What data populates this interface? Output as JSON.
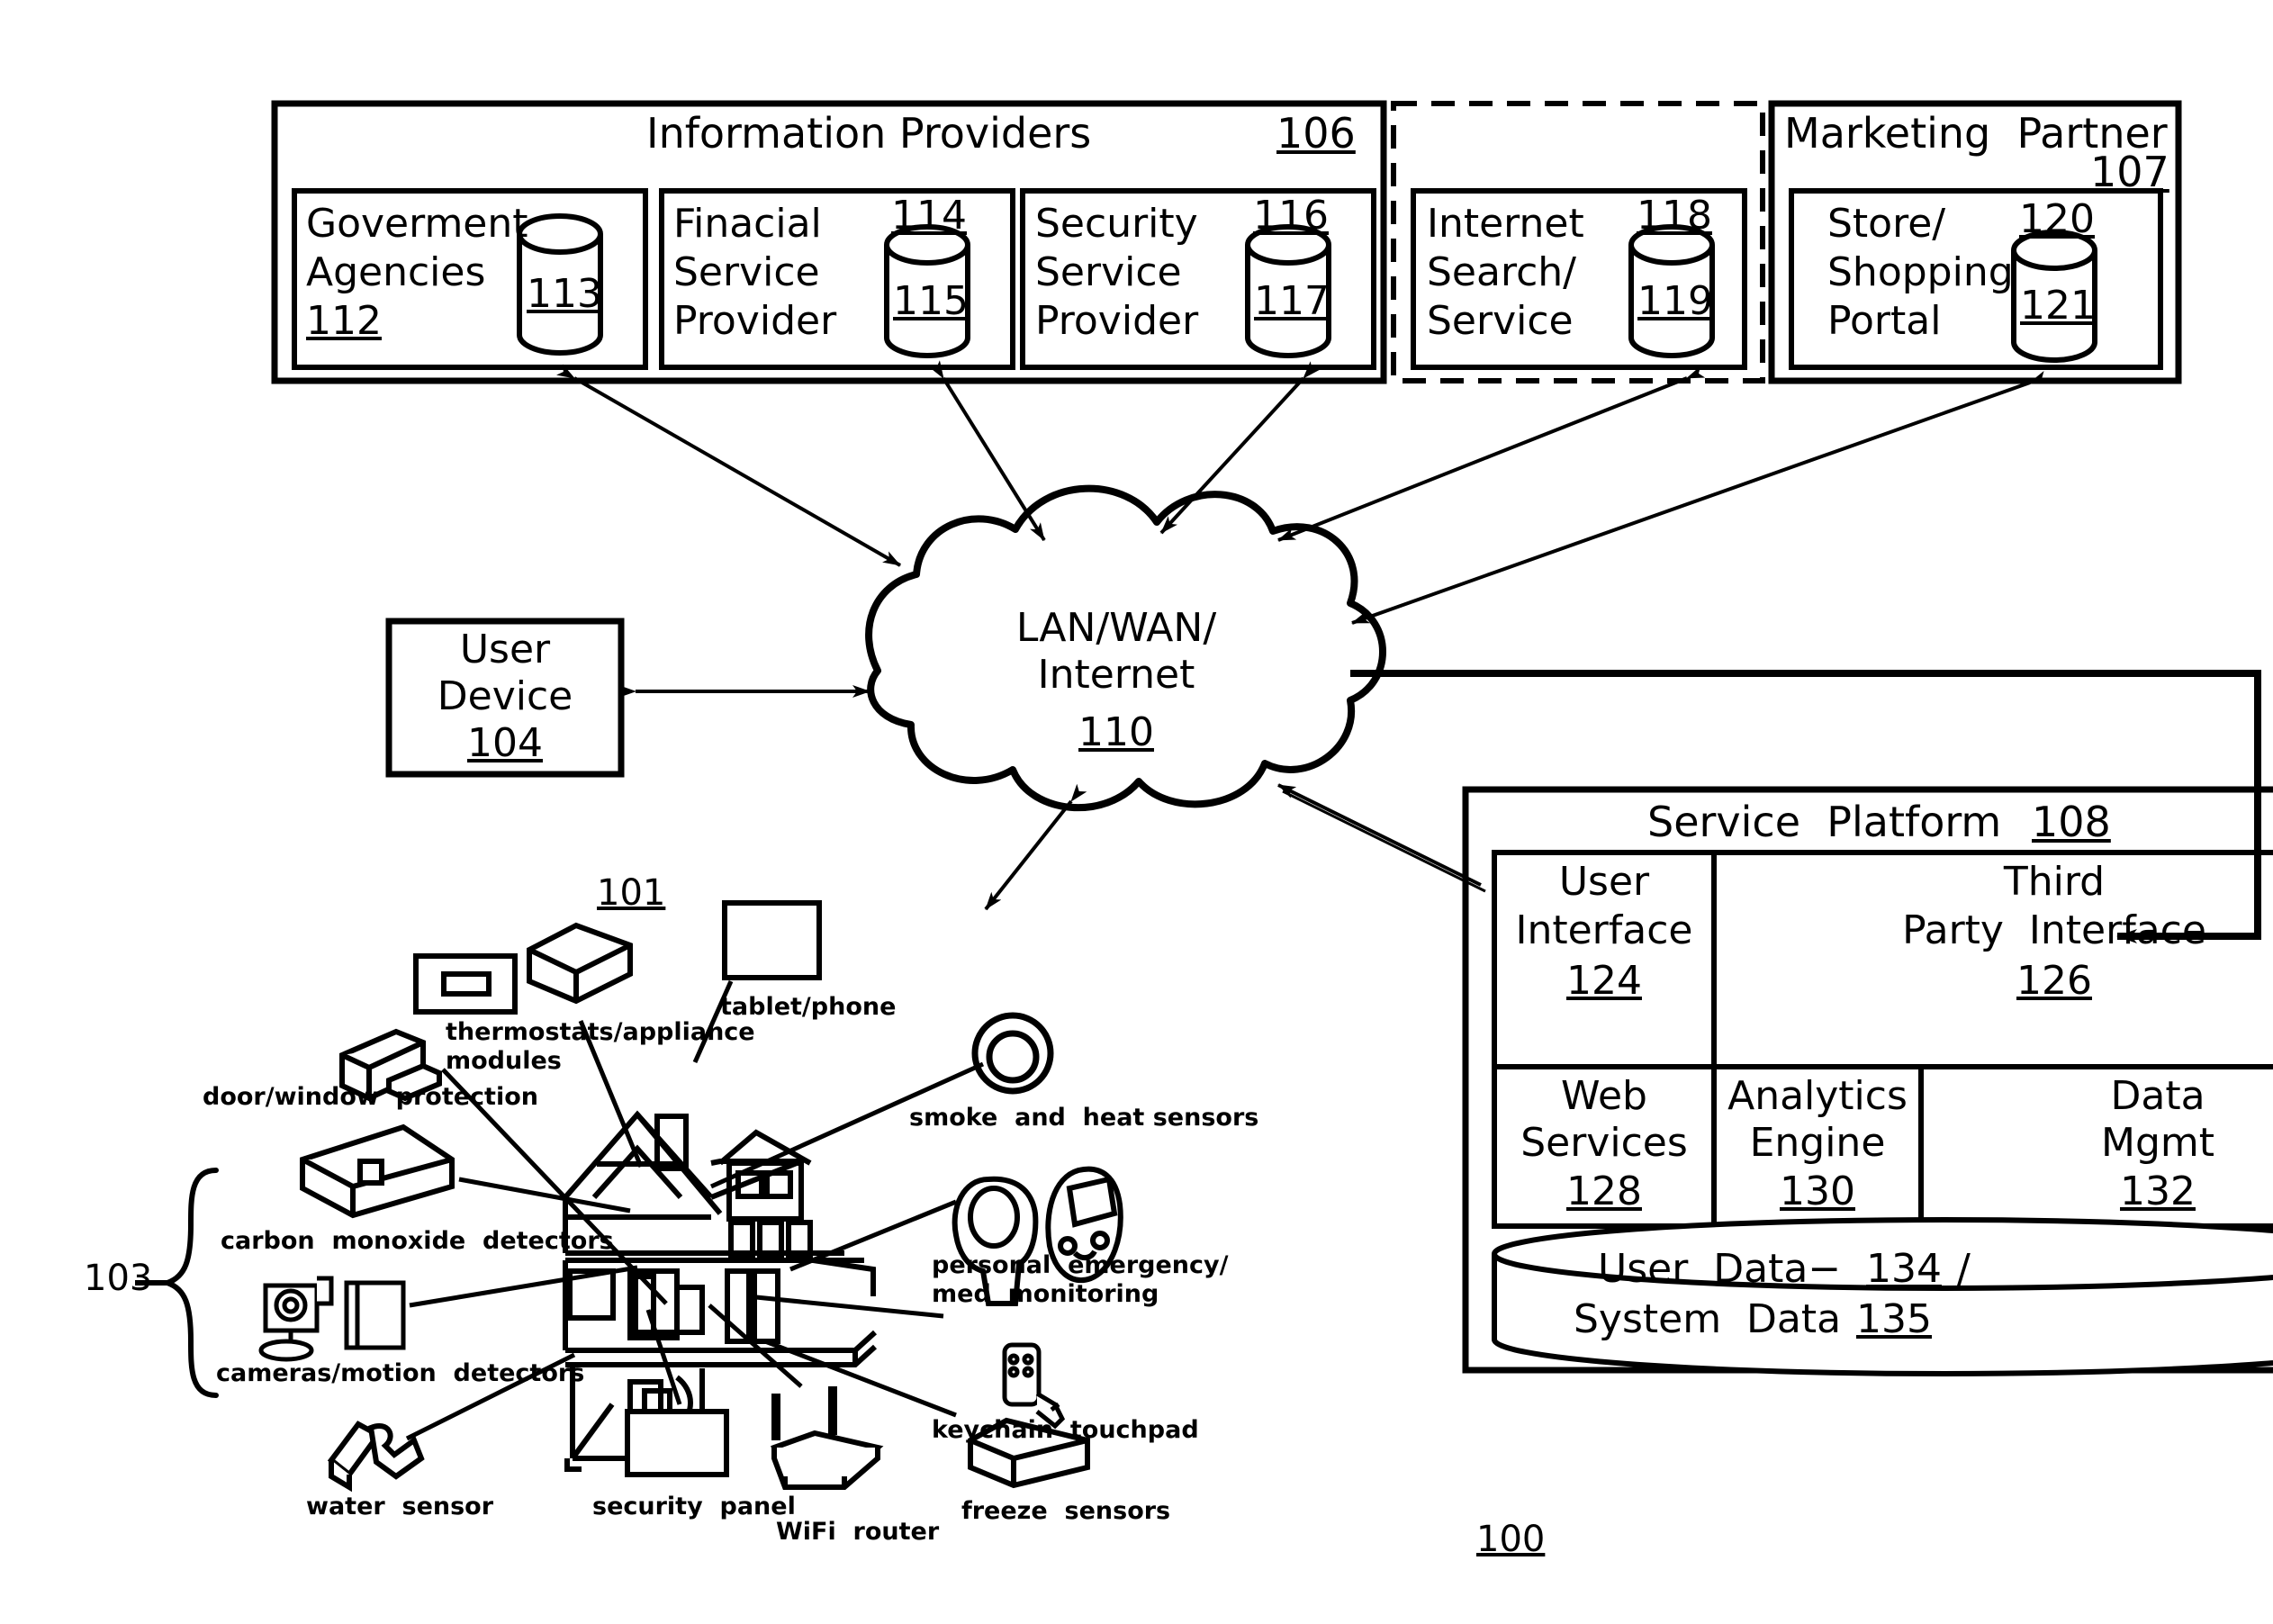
{
  "figure": {
    "number": "100"
  },
  "top_groups": [
    {
      "title": "Information Providers",
      "ref": "106",
      "border": "solid",
      "boxes": [
        {
          "lines": [
            "Goverment",
            "Agencies"
          ],
          "box_ref": "112",
          "box_ref_inline": true,
          "db_ref": "113"
        },
        {
          "lines": [
            "Finacial",
            "Service",
            "Provider"
          ],
          "box_ref": "114",
          "box_ref_inline": false,
          "db_ref": "115"
        },
        {
          "lines": [
            "Security",
            "Service",
            "Provider"
          ],
          "box_ref": "116",
          "box_ref_inline": false,
          "db_ref": "117"
        }
      ]
    },
    {
      "title": "",
      "ref": "",
      "border": "dashed",
      "boxes": [
        {
          "lines": [
            "Internet",
            "Search/",
            "Service"
          ],
          "box_ref": "118",
          "box_ref_inline": false,
          "db_ref": "119"
        }
      ]
    },
    {
      "title": "Marketing  Partner",
      "ref": "107",
      "border": "solid",
      "boxes": [
        {
          "lines": [
            "Store/",
            "Shopping",
            "Portal"
          ],
          "box_ref": "120",
          "box_ref_inline": false,
          "db_ref": "121"
        }
      ]
    }
  ],
  "user_device": {
    "lines": [
      "User",
      "Device"
    ],
    "ref": "104"
  },
  "cloud": {
    "lines": [
      "LAN/WAN/",
      "Internet"
    ],
    "ref": "110"
  },
  "service_platform": {
    "title": "Service  Platform",
    "ref": "108",
    "cells_row1": [
      {
        "lines": [
          "User",
          "Interface"
        ],
        "ref": "124"
      },
      {
        "lines": [
          "Third",
          "Party  Interface"
        ],
        "ref": "126"
      }
    ],
    "cells_row2": [
      {
        "lines": [
          "Web",
          "Services"
        ],
        "ref": "128"
      },
      {
        "lines": [
          "Analytics",
          "Engine"
        ],
        "ref": "130"
      },
      {
        "lines": [
          "Data",
          "Mgmt"
        ],
        "ref": "132"
      }
    ],
    "database": {
      "line1_a": "User  Data−",
      "line1_ref": "134",
      "line1_b": " /",
      "line2_a": "System  Data ",
      "line2_ref": "135"
    }
  },
  "home": {
    "ref": "101",
    "group_ref": "103",
    "devices": [
      {
        "label": "door/window  protection",
        "icon": "door-window-sensor-icon"
      },
      {
        "label_line1": "thermostats/appliance",
        "label_line2": "modules",
        "icon": "thermostat-icon"
      },
      {
        "label": "tablet/phone",
        "icon": "tablet-phone-icon"
      },
      {
        "label": "smoke  and  heat sensors",
        "icon": "smoke-heat-sensor-icon"
      },
      {
        "label": "carbon  monoxide  detectors",
        "icon": "carbon-monoxide-detector-icon"
      },
      {
        "label": "cameras/motion  detectors",
        "icon": "camera-motion-detector-icon"
      },
      {
        "label": "water  sensor",
        "icon": "water-sensor-icon"
      },
      {
        "label": "security  panel",
        "icon": "security-panel-icon"
      },
      {
        "label": "WiFi  router",
        "icon": "wifi-router-icon"
      },
      {
        "label_line1": "personal  emergency/",
        "label_line2": "med  monitoring",
        "icon": "personal-emergency-icon"
      },
      {
        "label": "keychain  touchpad",
        "icon": "keychain-touchpad-icon"
      },
      {
        "label": "freeze  sensors",
        "icon": "freeze-sensor-icon"
      }
    ]
  },
  "colors": {
    "ink": "#000000",
    "paper": "#ffffff"
  }
}
